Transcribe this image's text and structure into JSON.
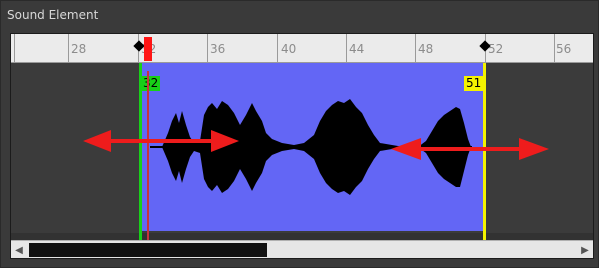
{
  "panel": {
    "title": "Sound Element"
  },
  "ruler": {
    "tick_labels": [
      "28",
      "32",
      "36",
      "40",
      "44",
      "48",
      "52",
      "56"
    ],
    "keyframe_markers": [
      "start-keyframe",
      "end-keyframe"
    ]
  },
  "track": {
    "start_frame": "32",
    "end_frame": "51",
    "colors": {
      "clip": "#6366f5",
      "start_marker": "#18d018",
      "end_marker": "#f4f200",
      "playhead": "#ff1515",
      "arrows": "#ee1c1c"
    }
  },
  "scrollbar": {
    "left_arrow": "◀",
    "right_arrow": "▶"
  },
  "icons": [
    "playhead-icon",
    "left-right-arrow-icon",
    "keyframe-diamond-icon"
  ]
}
